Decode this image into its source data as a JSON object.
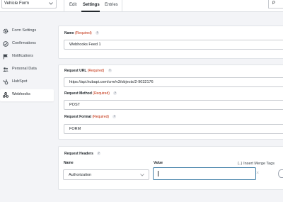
{
  "topbar": {
    "form_selector": "Vehicle Form",
    "tabs": [
      {
        "label": "Edit"
      },
      {
        "label": "Settings"
      },
      {
        "label": "Entries"
      }
    ],
    "corner_label": "P"
  },
  "sidebar": {
    "items": [
      {
        "label": "Form Settings",
        "icon": "gear-icon"
      },
      {
        "label": "Confirmations",
        "icon": "check-circle-icon"
      },
      {
        "label": "Notifications",
        "icon": "flag-icon"
      },
      {
        "label": "Personal Data",
        "icon": "users-icon"
      },
      {
        "label": "HubSpot",
        "icon": "hubspot-icon"
      },
      {
        "label": "Webhooks",
        "icon": "webhooks-icon"
      }
    ],
    "active_index": 5
  },
  "feed": {
    "name_label": "Name",
    "required_text": "(Required)",
    "name_value": "Webhooks Feed 1"
  },
  "request": {
    "url_label": "Request URL",
    "url_value": "https://api.hubapi.com/crm/v3/objects/2-9032176",
    "method_label": "Request Method",
    "method_value": "POST",
    "format_label": "Request Format",
    "format_value": "FORM"
  },
  "headers": {
    "section_label": "Request Headers",
    "name_col": "Name",
    "value_col": "Value",
    "name_value": "Authorization",
    "merge_tags_label": "Insert Merge Tags",
    "value_value": ""
  },
  "help_glyph": "?",
  "colors": {
    "required": "#c02b0a",
    "focus_border": "#3e7da6",
    "background": "#f3f4f7"
  }
}
